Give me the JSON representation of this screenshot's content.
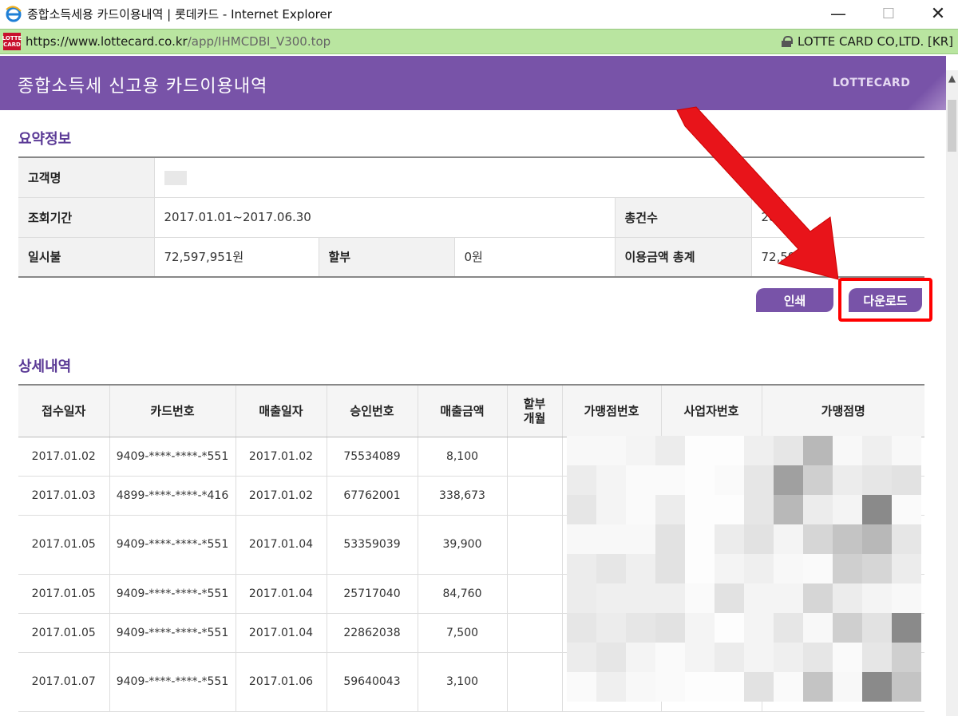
{
  "window": {
    "title": "종합소득세용 카드이용내역 | 롯데카드 - Internet Explorer",
    "minimize": "—",
    "maximize": "☐",
    "close": "✕"
  },
  "address": {
    "site_icon": "LOTTE CARD",
    "url_host": "https://www.lottecard.co.kr",
    "url_path": "/app/IHMCDBI_V300.top",
    "cert_label": "LOTTE CARD CO,LTD. [KR]"
  },
  "header": {
    "title": "종합소득세 신고용 카드이용내역",
    "logo": "LOTTECARD"
  },
  "summary": {
    "section_title": "요약정보",
    "customer_label": "고객명",
    "period_label": "조회기간",
    "period_value": "2017.01.01~2017.06.30",
    "count_label": "총건수",
    "count_value": "28",
    "lump_label": "일시불",
    "lump_value": "72,597,951원",
    "installment_label": "할부",
    "installment_value": "0원",
    "total_label": "이용금액 총계",
    "total_value": "72,59"
  },
  "buttons": {
    "print": "인쇄",
    "download": "다운로드"
  },
  "detail": {
    "section_title": "상세내역",
    "headers": [
      "접수일자",
      "카드번호",
      "매출일자",
      "승인번호",
      "매출금액",
      "할부\n개월",
      "가맹점번호",
      "사업자번호",
      "가맹점명"
    ],
    "rows": [
      {
        "received": "2017.01.02",
        "card": "9409-****-****-*551",
        "sale_date": "2017.01.02",
        "approval": "75534089",
        "amount": "8,100"
      },
      {
        "received": "2017.01.03",
        "card": "4899-****-****-*416",
        "sale_date": "2017.01.02",
        "approval": "67762001",
        "amount": "338,673"
      },
      {
        "received": "2017.01.05",
        "card": "9409-****-****-*551",
        "sale_date": "2017.01.04",
        "approval": "53359039",
        "amount": "39,900"
      },
      {
        "received": "2017.01.05",
        "card": "9409-****-****-*551",
        "sale_date": "2017.01.04",
        "approval": "25717040",
        "amount": "84,760"
      },
      {
        "received": "2017.01.05",
        "card": "9409-****-****-*551",
        "sale_date": "2017.01.04",
        "approval": "22862038",
        "amount": "7,500"
      },
      {
        "received": "2017.01.07",
        "card": "9409-****-****-*551",
        "sale_date": "2017.01.06",
        "approval": "59640043",
        "amount": "3,100"
      }
    ]
  },
  "colors": {
    "brand_purple": "#7853a8",
    "section_title": "#5b3a96",
    "address_green": "#b9e5a0",
    "highlight_red": "#ff0000"
  }
}
